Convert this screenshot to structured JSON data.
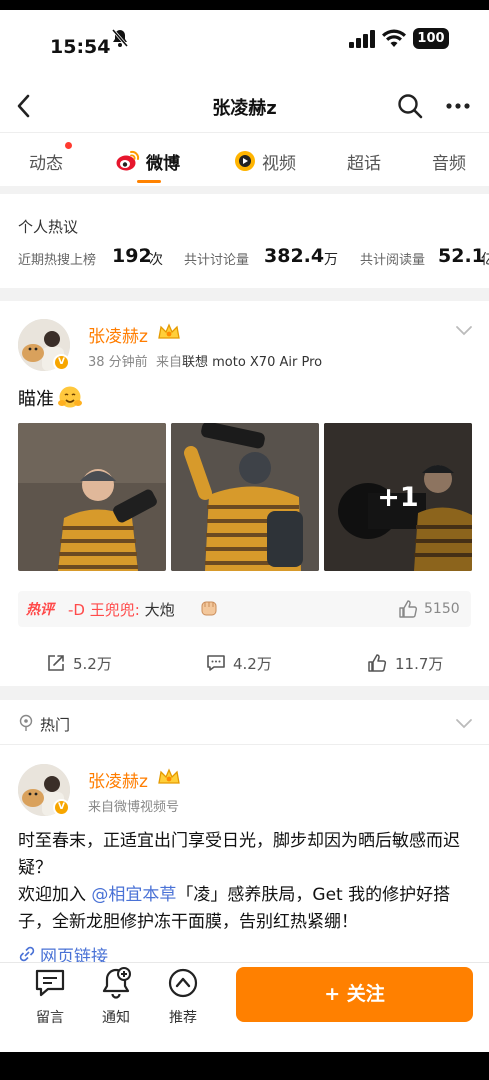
{
  "status_bar": {
    "time": "15:54",
    "battery": "100"
  },
  "nav": {
    "title": "张凌赫z"
  },
  "tabs": [
    {
      "label": "动态",
      "has_badge": true
    },
    {
      "label": "微博",
      "active": true
    },
    {
      "label": "视频"
    },
    {
      "label": "超话"
    },
    {
      "label": "音频"
    }
  ],
  "hot_stats": {
    "title": "个人热议",
    "items": [
      {
        "label": "近期热搜上榜",
        "value": "192",
        "unit": "次"
      },
      {
        "label": "共计讨论量",
        "value": "382.4",
        "unit": "万"
      },
      {
        "label": "共计阅读量",
        "value": "52.1",
        "unit": "亿"
      }
    ]
  },
  "post1": {
    "username": "张凌赫z",
    "time": "38 分钟前",
    "source_prefix": "来自",
    "source": "联想 moto X70 Air Pro",
    "text": "瞄准",
    "more_count": "+1",
    "hot_comment": {
      "badge": "热评",
      "user": "-D 王兜兜:",
      "text": " 大炮",
      "likes": "5150"
    },
    "actions": {
      "reposts": "5.2万",
      "comments": "4.2万",
      "likes": "11.7万"
    }
  },
  "post2": {
    "section_label": "热门",
    "username": "张凌赫z",
    "source": "来自微博视频号",
    "line1": "时至春末，正适宜出门享受日光，脚步却因为晒后敏感而迟疑？",
    "line2_pre": "欢迎加入 ",
    "mention": "@相宜本草",
    "line2_post": "「凌」感养肤局，Get 我的修护好搭子，全新龙胆修护冻干面膜，告别红热紧绷！",
    "link_text": "网页链接"
  },
  "bottom_bar": {
    "message": "留言",
    "notify": "通知",
    "recommend": "推荐",
    "follow": "+ 关注"
  },
  "colors": {
    "accent": "#ff8000",
    "username": "#ff7d00",
    "link": "#4a72d6",
    "hot_comment": "#ff4a4a"
  }
}
